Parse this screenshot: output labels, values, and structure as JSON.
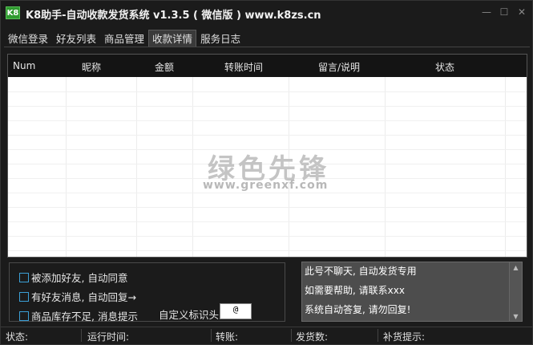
{
  "app": {
    "logo": "K8",
    "title": "K8助手-自动收款发货系统 v1.3.5 ( 微信版 ) www.k8zs.cn"
  },
  "window_controls": {
    "minimize": "—",
    "maximize": "☐",
    "close": "✕"
  },
  "tabs": [
    {
      "label": "微信登录"
    },
    {
      "label": "好友列表"
    },
    {
      "label": "商品管理"
    },
    {
      "label": "收款详情",
      "active": true
    },
    {
      "label": "服务日志"
    }
  ],
  "table": {
    "columns": [
      "Num",
      "昵称",
      "金额",
      "转账时间",
      "留言/说明",
      "状态"
    ],
    "rows": []
  },
  "watermark": {
    "main": "绿色先锋",
    "sub": "www.greenxf.com"
  },
  "options": {
    "auto_accept_friend": {
      "label": "被添加好友, 自动同意",
      "checked": false
    },
    "auto_reply": {
      "label": "有好友消息, 自动回复→",
      "checked": false
    },
    "stock_alert": {
      "label": "商品库存不足, 消息提示",
      "checked": false
    },
    "prefix_label": "自定义标识头",
    "prefix_value": "@"
  },
  "messages": {
    "lines": [
      "此号不聊天, 自动发货专用",
      "如需要帮助, 请联系xxx",
      "系统自动答复, 请勿回复!"
    ]
  },
  "statusbar": {
    "status": "状态:",
    "runtime": "运行时间:",
    "transfer": "转账:",
    "shipped": "发货数:",
    "restock": "补货提示:"
  },
  "colors": {
    "accent": "#2f9a2f",
    "checkbox": "#3b9fd6",
    "background": "#1b1b1b"
  }
}
